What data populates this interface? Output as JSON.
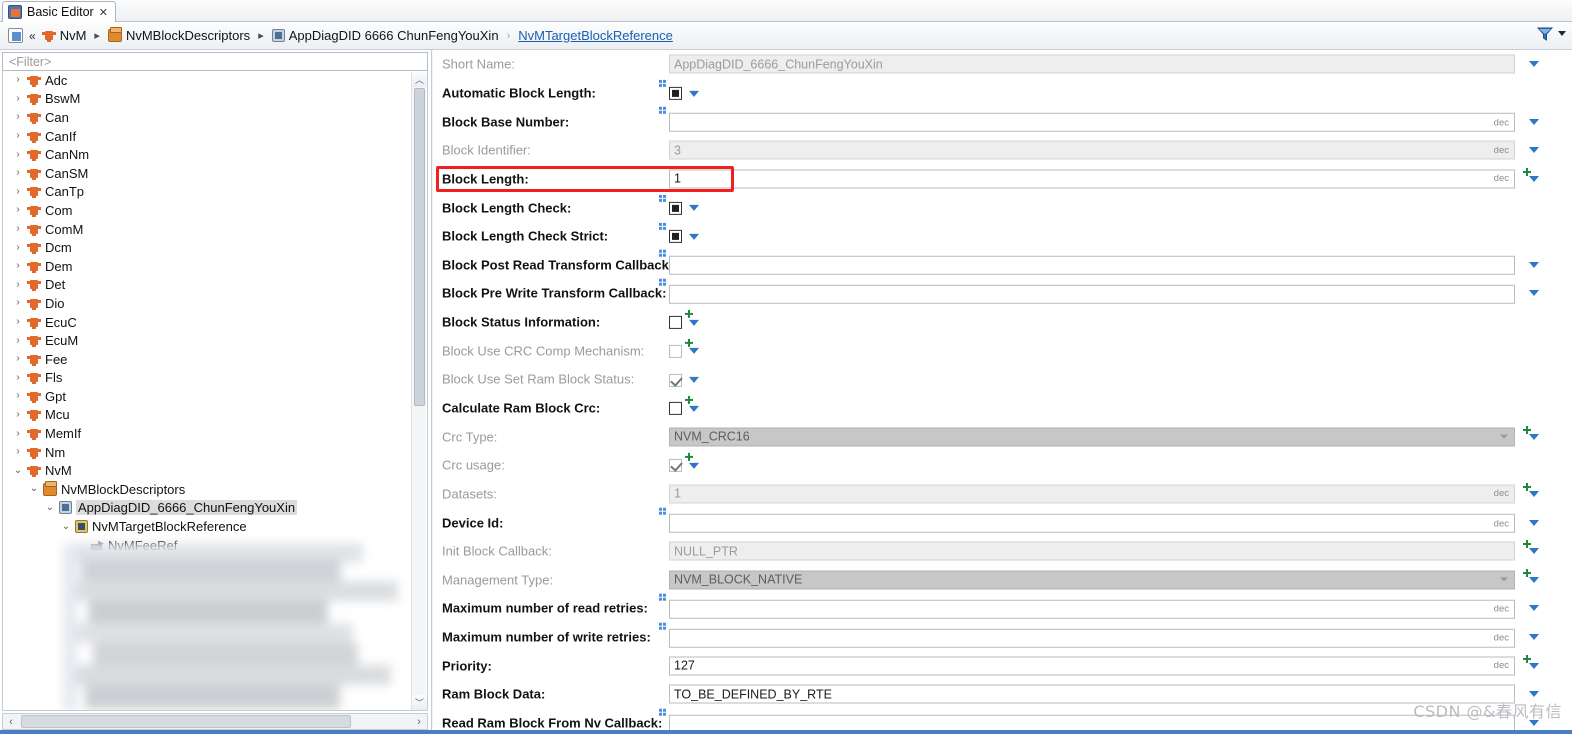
{
  "window": {
    "tab_label": "Basic Editor",
    "tab_close": "✕",
    "tab_icon": "editor-icon"
  },
  "breadcrumb": {
    "home_icon": "home-icon",
    "collapse_glyph": "«",
    "separator": "▸",
    "separator_light": "›",
    "items": [
      {
        "label": "NvM",
        "icon": "plug-icon"
      },
      {
        "label": "NvMBlockDescriptors",
        "icon": "package-icon"
      },
      {
        "label": "AppDiagDID 6666 ChunFengYouXin",
        "icon": "container-icon"
      }
    ],
    "current_link": "NvMTargetBlockReference",
    "filter_icon": "filter-funnel-icon",
    "filter_caret": "chevron-down-icon"
  },
  "tree": {
    "filter_placeholder": "<Filter>",
    "scroll_up_glyph": "︿",
    "scroll_down_glyph": "﹀",
    "hscroll_left_glyph": "‹",
    "hscroll_right_glyph": "›",
    "expand_collapsed": "›",
    "expand_expanded": "⌄",
    "items": [
      {
        "label": "Adc",
        "indent": 0,
        "icon": "plug-icon",
        "state": "collapsed"
      },
      {
        "label": "BswM",
        "indent": 0,
        "icon": "plug-icon",
        "state": "collapsed"
      },
      {
        "label": "Can",
        "indent": 0,
        "icon": "plug-icon",
        "state": "collapsed"
      },
      {
        "label": "CanIf",
        "indent": 0,
        "icon": "plug-icon",
        "state": "collapsed"
      },
      {
        "label": "CanNm",
        "indent": 0,
        "icon": "plug-icon",
        "state": "collapsed"
      },
      {
        "label": "CanSM",
        "indent": 0,
        "icon": "plug-icon",
        "state": "collapsed"
      },
      {
        "label": "CanTp",
        "indent": 0,
        "icon": "plug-icon",
        "state": "collapsed"
      },
      {
        "label": "Com",
        "indent": 0,
        "icon": "plug-icon",
        "state": "collapsed"
      },
      {
        "label": "ComM",
        "indent": 0,
        "icon": "plug-icon",
        "state": "collapsed"
      },
      {
        "label": "Dcm",
        "indent": 0,
        "icon": "plug-icon",
        "state": "collapsed"
      },
      {
        "label": "Dem",
        "indent": 0,
        "icon": "plug-icon",
        "state": "collapsed"
      },
      {
        "label": "Det",
        "indent": 0,
        "icon": "plug-icon",
        "state": "collapsed"
      },
      {
        "label": "Dio",
        "indent": 0,
        "icon": "plug-icon",
        "state": "collapsed"
      },
      {
        "label": "EcuC",
        "indent": 0,
        "icon": "plug-icon",
        "state": "collapsed"
      },
      {
        "label": "EcuM",
        "indent": 0,
        "icon": "plug-icon",
        "state": "collapsed"
      },
      {
        "label": "Fee",
        "indent": 0,
        "icon": "plug-icon",
        "state": "collapsed"
      },
      {
        "label": "Fls",
        "indent": 0,
        "icon": "plug-icon",
        "state": "collapsed"
      },
      {
        "label": "Gpt",
        "indent": 0,
        "icon": "plug-icon",
        "state": "collapsed"
      },
      {
        "label": "Mcu",
        "indent": 0,
        "icon": "plug-icon",
        "state": "collapsed"
      },
      {
        "label": "MemIf",
        "indent": 0,
        "icon": "plug-icon",
        "state": "collapsed"
      },
      {
        "label": "Nm",
        "indent": 0,
        "icon": "plug-icon",
        "state": "collapsed"
      },
      {
        "label": "NvM",
        "indent": 0,
        "icon": "plug-icon",
        "state": "expanded"
      },
      {
        "label": "NvMBlockDescriptors",
        "indent": 1,
        "icon": "package-icon",
        "state": "expanded"
      },
      {
        "label": "AppDiagDID_6666_ChunFengYouXin",
        "indent": 2,
        "icon": "container-icon",
        "state": "expanded",
        "selected": true
      },
      {
        "label": "NvMTargetBlockReference",
        "indent": 3,
        "icon": "container-gold-icon",
        "state": "expanded"
      },
      {
        "label": "NvMFeeRef",
        "indent": 4,
        "icon": "reference-icon",
        "state": "leaf"
      }
    ]
  },
  "form": {
    "dec_label": "dec",
    "rows": [
      {
        "label": "Short Name:",
        "dim": true,
        "control": "text",
        "value": "AppDiagDID_6666_ChunFengYouXin",
        "style": "readonly",
        "dec": false,
        "arrow": true,
        "green": false,
        "blue": false
      },
      {
        "label": "Automatic Block Length:",
        "dim": false,
        "control": "checkbox",
        "value": "filled",
        "dec": false,
        "arrow": false,
        "green": false,
        "blue": true
      },
      {
        "label": "Block Base Number:",
        "dim": false,
        "control": "text",
        "value": "",
        "style": "normal",
        "dec": true,
        "arrow": true,
        "green": false,
        "blue": true
      },
      {
        "label": "Block Identifier:",
        "dim": true,
        "control": "text",
        "value": "3",
        "style": "readonly",
        "dec": true,
        "arrow": true,
        "green": false,
        "blue": false
      },
      {
        "label": "Block Length:",
        "dim": false,
        "control": "text",
        "value": "1",
        "style": "normal",
        "dec": true,
        "arrow": true,
        "green": true,
        "blue": false,
        "highlight": true
      },
      {
        "label": "Block Length Check:",
        "dim": false,
        "control": "checkbox",
        "value": "filled",
        "dec": false,
        "arrow": false,
        "green": false,
        "blue": true
      },
      {
        "label": "Block Length Check Strict:",
        "dim": false,
        "control": "checkbox",
        "value": "filled",
        "dec": false,
        "arrow": false,
        "green": false,
        "blue": true
      },
      {
        "label": "Block Post Read Transform Callback:",
        "dim": false,
        "control": "text",
        "value": "",
        "style": "normal",
        "dec": false,
        "arrow": true,
        "green": false,
        "blue": true
      },
      {
        "label": "Block Pre Write Transform Callback:",
        "dim": false,
        "control": "text",
        "value": "",
        "style": "normal",
        "dec": false,
        "arrow": true,
        "green": false,
        "blue": true
      },
      {
        "label": "Block Status Information:",
        "dim": false,
        "control": "checkbox",
        "value": "empty",
        "dec": false,
        "arrow": false,
        "green": true,
        "blue": false
      },
      {
        "label": "Block Use CRC Comp Mechanism:",
        "dim": true,
        "control": "checkbox",
        "value": "empty-dim",
        "dec": false,
        "arrow": false,
        "green": true,
        "blue": false
      },
      {
        "label": "Block Use Set Ram Block Status:",
        "dim": true,
        "control": "checkbox",
        "value": "checked-dim",
        "dec": false,
        "arrow": false,
        "green": false,
        "blue": false
      },
      {
        "label": "Calculate Ram Block Crc:",
        "dim": false,
        "control": "checkbox",
        "value": "empty",
        "dec": false,
        "arrow": false,
        "green": true,
        "blue": false
      },
      {
        "label": "Crc Type:",
        "dim": true,
        "control": "text",
        "value": "NVM_CRC16",
        "style": "combo",
        "dec": false,
        "arrow": true,
        "green": true,
        "blue": false
      },
      {
        "label": "Crc usage:",
        "dim": true,
        "control": "checkbox",
        "value": "checked-dim",
        "dec": false,
        "arrow": false,
        "green": true,
        "blue": false
      },
      {
        "label": "Datasets:",
        "dim": true,
        "control": "text",
        "value": "1",
        "style": "readonly",
        "dec": true,
        "arrow": true,
        "green": true,
        "blue": false
      },
      {
        "label": "Device Id:",
        "dim": false,
        "control": "text",
        "value": "",
        "style": "normal",
        "dec": true,
        "arrow": true,
        "green": false,
        "blue": true
      },
      {
        "label": "Init Block Callback:",
        "dim": true,
        "control": "text",
        "value": "NULL_PTR",
        "style": "readonly",
        "dec": false,
        "arrow": true,
        "green": true,
        "blue": false
      },
      {
        "label": "Management Type:",
        "dim": true,
        "control": "text",
        "value": "NVM_BLOCK_NATIVE",
        "style": "combo",
        "dec": false,
        "arrow": true,
        "green": true,
        "blue": false
      },
      {
        "label": "Maximum number of read retries:",
        "dim": false,
        "control": "text",
        "value": "",
        "style": "normal",
        "dec": true,
        "arrow": true,
        "green": false,
        "blue": true
      },
      {
        "label": "Maximum number of write retries:",
        "dim": false,
        "control": "text",
        "value": "",
        "style": "normal",
        "dec": true,
        "arrow": true,
        "green": false,
        "blue": true
      },
      {
        "label": "Priority:",
        "dim": false,
        "control": "text",
        "value": "127",
        "style": "normal",
        "dec": true,
        "arrow": true,
        "green": true,
        "blue": false
      },
      {
        "label": "Ram Block Data:",
        "dim": false,
        "control": "text",
        "value": "TO_BE_DEFINED_BY_RTE",
        "style": "normal",
        "dec": false,
        "arrow": true,
        "green": false,
        "blue": false
      },
      {
        "label": "Read Ram Block From Nv Callback:",
        "dim": false,
        "control": "text",
        "value": "",
        "style": "normal",
        "dec": false,
        "arrow": true,
        "green": false,
        "blue": true
      }
    ]
  },
  "watermark": {
    "text": "CSDN @&春风有信"
  },
  "colors": {
    "accent_blue": "#2f76c4",
    "link_blue": "#1b5fb0",
    "highlight_red": "#f02020",
    "plug_orange": "#e3682c",
    "marker_green": "#1d8a3a",
    "status_bar": "#4a7fc1"
  }
}
